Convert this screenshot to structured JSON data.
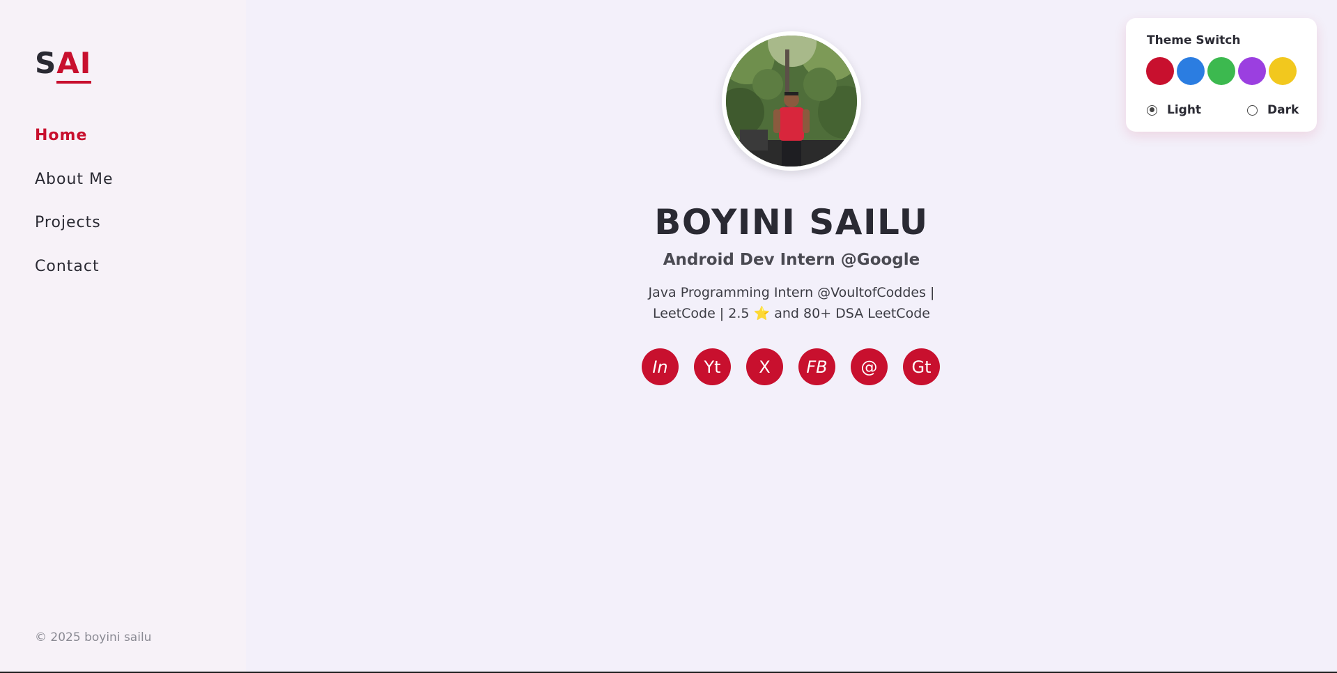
{
  "sidebar": {
    "logo": {
      "part1": "S",
      "part2": "AI"
    },
    "nav": [
      {
        "label": "Home",
        "active": true
      },
      {
        "label": "About Me",
        "active": false
      },
      {
        "label": "Projects",
        "active": false
      },
      {
        "label": "Contact",
        "active": false
      }
    ],
    "copyright": "© 2025 boyini sailu"
  },
  "profile": {
    "avatar_icon": "profile-photo",
    "name": "BOYINI SAILU",
    "subtitle": "Android Dev Intern @Google",
    "desc_line1": "Java Programming Intern @VoultofCoddes |",
    "desc_line2_a": "LeetCode | 2.5 ",
    "desc_star": "⭐",
    "desc_line2_b": " and 80+ DSA LeetCode",
    "socials": [
      {
        "label": "In",
        "icon": "linkedin-icon",
        "italic": true
      },
      {
        "label": "Yt",
        "icon": "youtube-icon",
        "italic": false
      },
      {
        "label": "X",
        "icon": "x-icon",
        "italic": false
      },
      {
        "label": "FB",
        "icon": "facebook-icon",
        "italic": true
      },
      {
        "label": "@",
        "icon": "email-icon",
        "italic": false
      },
      {
        "label": "Gt",
        "icon": "github-icon",
        "italic": false
      }
    ]
  },
  "theme_switch": {
    "title": "Theme Switch",
    "colors": [
      "#c8102e",
      "#2b7de1",
      "#3cb94f",
      "#9b3fe0",
      "#f2c81e"
    ],
    "modes": [
      {
        "label": "Light",
        "checked": true
      },
      {
        "label": "Dark",
        "checked": false
      }
    ]
  },
  "colors": {
    "accent": "#c8102e",
    "background": "#f3f0fa",
    "sidebar_bg": "#f7f2f8"
  }
}
